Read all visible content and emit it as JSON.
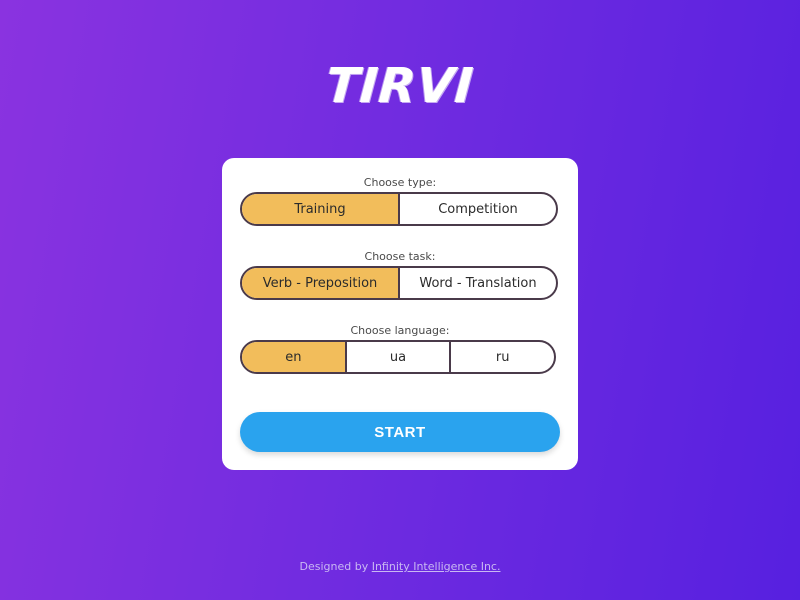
{
  "app": {
    "logo_text": "TIRVI"
  },
  "type_selector": {
    "label": "Choose type:",
    "options": [
      "Training",
      "Competition"
    ],
    "selected": "Training"
  },
  "task_selector": {
    "label": "Choose task:",
    "options": [
      "Verb - Preposition",
      "Word - Translation"
    ],
    "selected": "Verb - Preposition"
  },
  "language_selector": {
    "label": "Choose language:",
    "options": [
      "en",
      "ua",
      "ru"
    ],
    "selected": "en"
  },
  "start_button": {
    "label": "START"
  },
  "footer": {
    "prefix": "Designed by",
    "link_text": "Infinity Intelligence Inc."
  },
  "colors": {
    "background_start": "#8a33e0",
    "background_end": "#5720e0",
    "selected_option": "#f2bd5b",
    "start_button": "#2aa3ee",
    "card": "#ffffff"
  }
}
